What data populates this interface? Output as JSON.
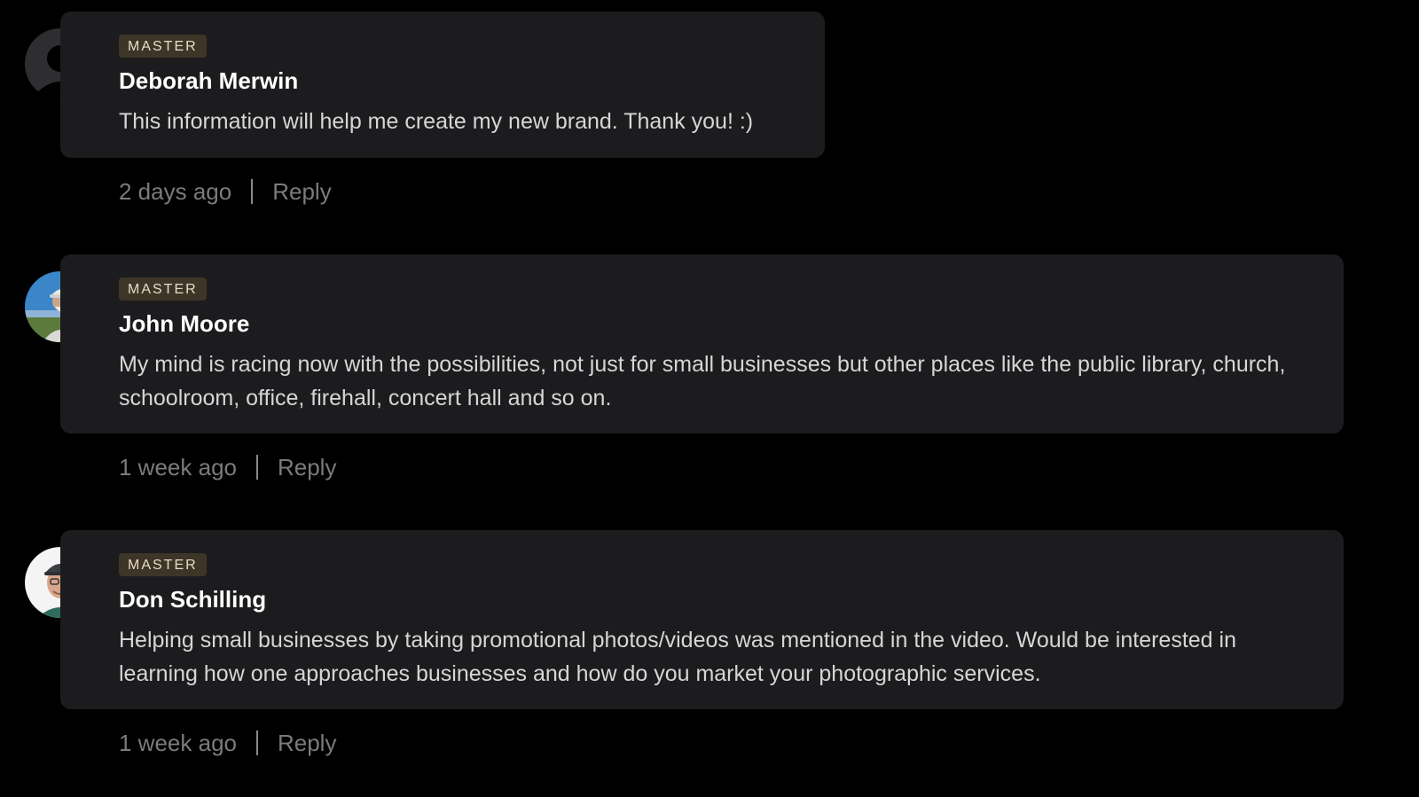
{
  "comments": [
    {
      "badge": "MASTER",
      "author": "Deborah Merwin",
      "text": "This information will help me create my new brand. Thank you! :)",
      "time": "2 days ago",
      "reply_label": "Reply",
      "avatar": "default-user-avatar"
    },
    {
      "badge": "MASTER",
      "author": "John Moore",
      "text": "My mind is racing now with the possibilities, not just for small businesses but other places like the public library, church, schoolroom, office, firehall, concert hall and so on.",
      "time": "1 week ago",
      "reply_label": "Reply",
      "avatar": "photo-avatar"
    },
    {
      "badge": "MASTER",
      "author": "Don Schilling",
      "text": "Helping small businesses by taking promotional photos/videos was mentioned in the video. Would be interested in learning how one approaches businesses and how do you market your photographic services.",
      "time": "1 week ago",
      "reply_label": "Reply",
      "avatar": "photo-avatar"
    }
  ],
  "colors": {
    "background": "#000000",
    "bubble": "#1c1c1e",
    "badge_bg": "#3d3527",
    "badge_text": "#e6dcc6",
    "author": "#ffffff",
    "body_text": "#d6d6d6",
    "meta_text": "#7b7b7b"
  }
}
